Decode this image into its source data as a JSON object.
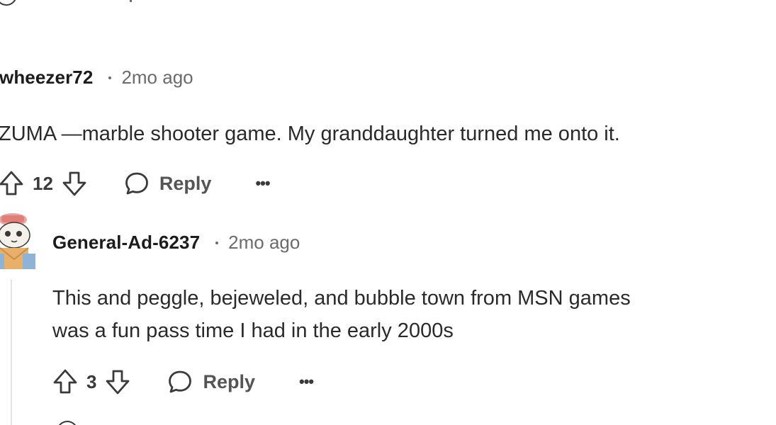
{
  "comments": [
    {
      "username": "wheezer72",
      "timestamp": "2mo ago",
      "body_lines": [
        "ZUMA —marble shooter game. My granddaughter turned me onto it."
      ],
      "votes": "12",
      "reply_label": "Reply",
      "more_label": "•••"
    },
    {
      "username": "General-Ad-6237",
      "timestamp": "2mo ago",
      "body_lines": [
        "This and peggle, bejeweled, and bubble town from MSN games",
        "was a fun pass time I had in the early 2000s"
      ],
      "votes": "3",
      "reply_label": "Reply",
      "more_label": "•••"
    }
  ],
  "icons": {
    "upvote": "upvote-arrow-icon",
    "downvote": "downvote-arrow-icon",
    "reply": "speech-bubble-icon",
    "more": "ellipsis-icon",
    "avatar": "cartoon-avatar"
  },
  "colors": {
    "text": "#1c1c1c",
    "muted": "#6b6b6b",
    "thread_line": "#e1e4e6"
  }
}
